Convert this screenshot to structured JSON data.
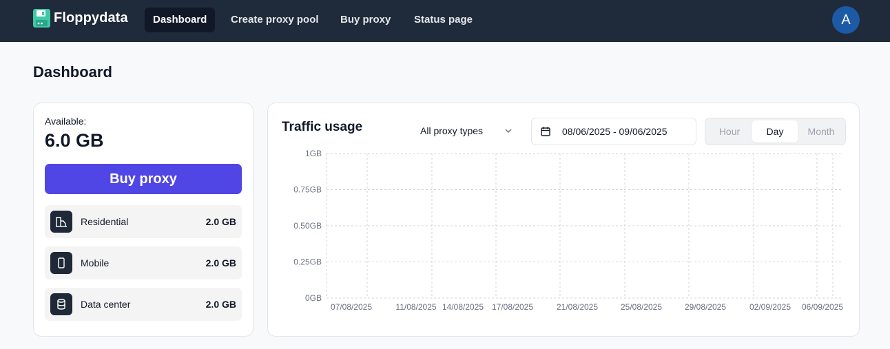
{
  "app": {
    "name": "Floppydata"
  },
  "nav": {
    "items": [
      {
        "label": "Dashboard",
        "active": true
      },
      {
        "label": "Create proxy pool",
        "active": false
      },
      {
        "label": "Buy proxy",
        "active": false
      },
      {
        "label": "Status page",
        "active": false
      }
    ],
    "avatar_initial": "A"
  },
  "page": {
    "title": "Dashboard"
  },
  "balance": {
    "available_label": "Available:",
    "available_value": "6.0 GB",
    "buy_button": "Buy proxy",
    "types": [
      {
        "icon": "building-icon",
        "name": "Residential",
        "value": "2.0 GB"
      },
      {
        "icon": "smartphone-icon",
        "name": "Mobile",
        "value": "2.0 GB"
      },
      {
        "icon": "database-icon",
        "name": "Data center",
        "value": "2.0 GB"
      }
    ]
  },
  "traffic": {
    "title": "Traffic usage",
    "proxy_filter": "All proxy types",
    "date_range": "08/06/2025 - 09/06/2025",
    "granularity": [
      {
        "label": "Hour",
        "active": false
      },
      {
        "label": "Day",
        "active": true
      },
      {
        "label": "Month",
        "active": false
      }
    ]
  },
  "colors": {
    "topbar": "#1f2a3a",
    "accent": "#5046e5",
    "avatar": "#1d5aa6",
    "logo": "#3ec9a7"
  },
  "chart_data": {
    "type": "line",
    "title": "",
    "xlabel": "",
    "ylabel": "",
    "ylim": [
      0,
      1
    ],
    "y_ticks": [
      "0GB",
      "0.25GB",
      "0.50GB",
      "0.75GB",
      "1GB"
    ],
    "x_ticks": [
      "07/08/2025",
      "11/08/2025",
      "14/08/2025",
      "17/08/2025",
      "21/08/2025",
      "25/08/2025",
      "29/08/2025",
      "02/09/2025",
      "06/09/2025"
    ],
    "series": [],
    "grid": true
  }
}
